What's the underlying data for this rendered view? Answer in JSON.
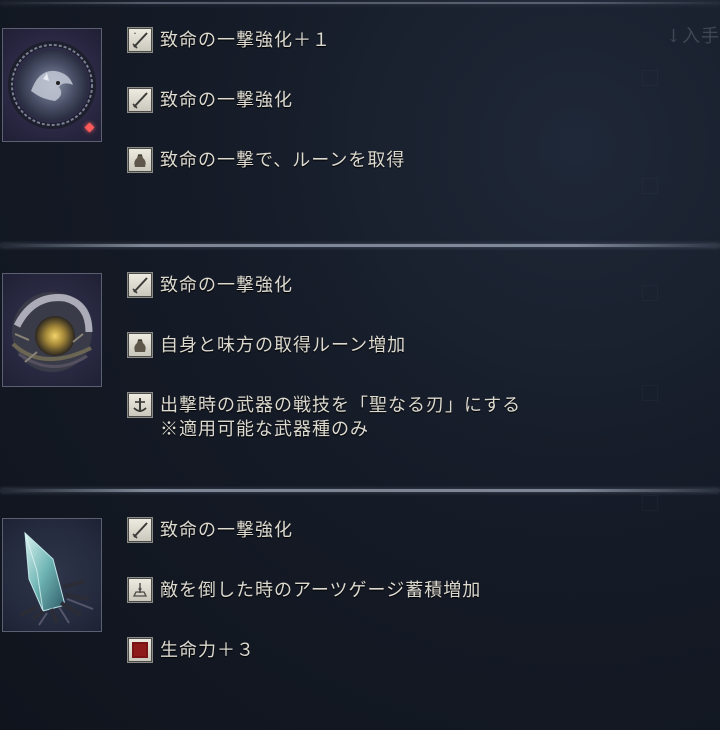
{
  "background": {
    "ghost_label": "↓入手",
    "colors": {
      "bg": "#151b27",
      "divider": "#aab4c6",
      "text": "#dcd9cf",
      "rarity_gem": "#ff5a5a"
    }
  },
  "relics": [
    {
      "icon": "dark-round-wolf-relic-icon",
      "rarity": "red-gem",
      "effects": [
        {
          "icon": "sword-icon",
          "text": "致命の一撃強化＋１"
        },
        {
          "icon": "sword-icon",
          "text": "致命の一撃強化"
        },
        {
          "icon": "rune-pouch-icon",
          "text": "致命の一撃で、ルーンを取得"
        }
      ]
    },
    {
      "icon": "golden-nest-relic-icon",
      "effects": [
        {
          "icon": "sword-icon",
          "text": "致命の一撃強化"
        },
        {
          "icon": "rune-pouch-icon",
          "text": "自身と味方の取得ルーン増加"
        },
        {
          "icon": "skill-anchor-icon",
          "text": "出撃時の武器の戦技を「聖なる刃」にする",
          "subtext": "※適用可能な武器種のみ"
        }
      ]
    },
    {
      "icon": "teal-crystal-relic-icon",
      "effects": [
        {
          "icon": "sword-icon",
          "text": "致命の一撃強化"
        },
        {
          "icon": "arts-gauge-icon",
          "text": "敵を倒した時のアーツゲージ蓄積増加"
        },
        {
          "icon": "red-vigor-icon",
          "text": "生命力＋３"
        }
      ]
    }
  ]
}
